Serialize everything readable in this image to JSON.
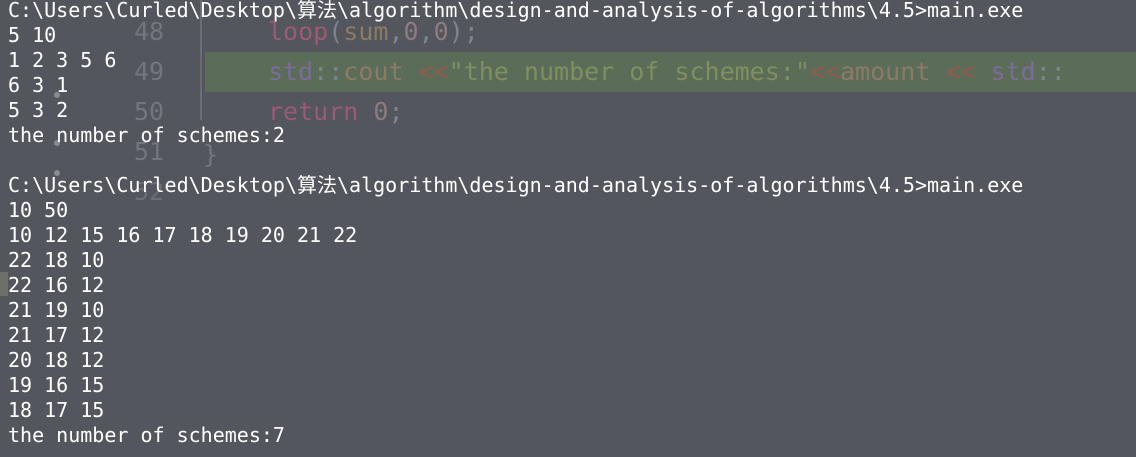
{
  "editor": {
    "lines": [
      {
        "num": "48",
        "code": "loop(sum,0,0);"
      },
      {
        "num": "49",
        "code": "std::cout <<\"the number of schemes:\"<<amount << std::"
      },
      {
        "num": "50",
        "code": "return 0;"
      },
      {
        "num": "51",
        "code": "}"
      },
      {
        "num": "52",
        "code": ""
      }
    ]
  },
  "console": {
    "lines": [
      "C:\\Users\\Curled\\Desktop\\算法\\algorithm\\design-and-analysis-of-algorithms\\4.5>main.exe",
      "5 10",
      "1 2 3 5 6",
      "6 3 1",
      "5 3 2",
      "the number of schemes:2",
      "",
      "C:\\Users\\Curled\\Desktop\\算法\\algorithm\\design-and-analysis-of-algorithms\\4.5>main.exe",
      "10 50",
      "10 12 15 16 17 18 19 20 21 22",
      "22 18 10",
      "22 16 12",
      "21 19 10",
      "21 17 12",
      "20 18 12",
      "19 16 15",
      "18 17 15",
      "the number of schemes:7"
    ]
  }
}
